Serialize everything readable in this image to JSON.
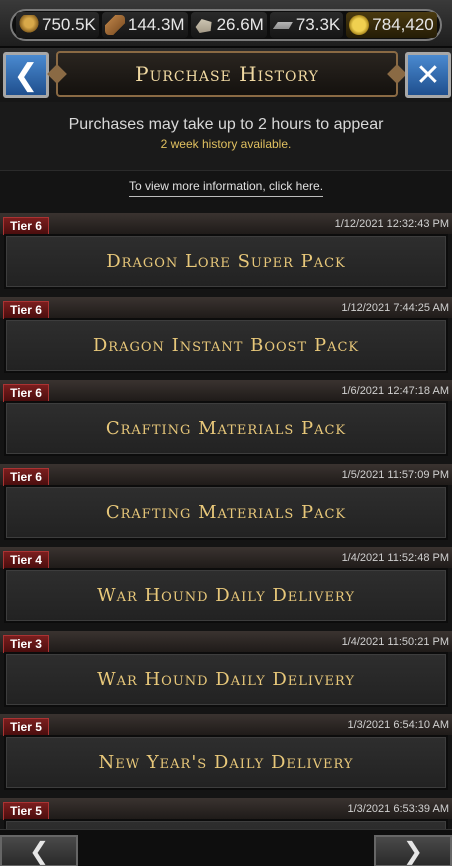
{
  "resources": [
    {
      "icon": "wheat-icon",
      "value": "750.5K"
    },
    {
      "icon": "wood-icon",
      "value": "144.3M"
    },
    {
      "icon": "stone-icon",
      "value": "26.6M"
    },
    {
      "icon": "iron-icon",
      "value": "73.3K"
    },
    {
      "icon": "gold-coin-icon",
      "value": "784,420"
    }
  ],
  "header": {
    "back_icon": "❮",
    "title": "Purchase History",
    "close_icon": "✕"
  },
  "info": {
    "message": "Purchases may take up to 2 hours to appear",
    "sub": "2 week history available.",
    "more_link": "To view more information, click here."
  },
  "purchases": [
    {
      "tier": "Tier 6",
      "timestamp": "1/12/2021 12:32:43 PM",
      "name": "Dragon Lore Super Pack"
    },
    {
      "tier": "Tier 6",
      "timestamp": "1/12/2021 7:44:25 AM",
      "name": "Dragon Instant Boost Pack"
    },
    {
      "tier": "Tier 6",
      "timestamp": "1/6/2021 12:47:18 AM",
      "name": "Crafting Materials Pack"
    },
    {
      "tier": "Tier 6",
      "timestamp": "1/5/2021 11:57:09 PM",
      "name": "Crafting Materials Pack"
    },
    {
      "tier": "Tier 4",
      "timestamp": "1/4/2021 11:52:48 PM",
      "name": "War Hound Daily Delivery"
    },
    {
      "tier": "Tier 3",
      "timestamp": "1/4/2021 11:50:21 PM",
      "name": "War Hound Daily Delivery"
    },
    {
      "tier": "Tier 5",
      "timestamp": "1/3/2021 6:54:10 AM",
      "name": "New Year's Daily Delivery"
    },
    {
      "tier": "Tier 5",
      "timestamp": "1/3/2021 6:53:39 AM",
      "name": ""
    }
  ],
  "bottom_nav": {
    "prev_icon": "❮",
    "next_icon": "❯"
  }
}
